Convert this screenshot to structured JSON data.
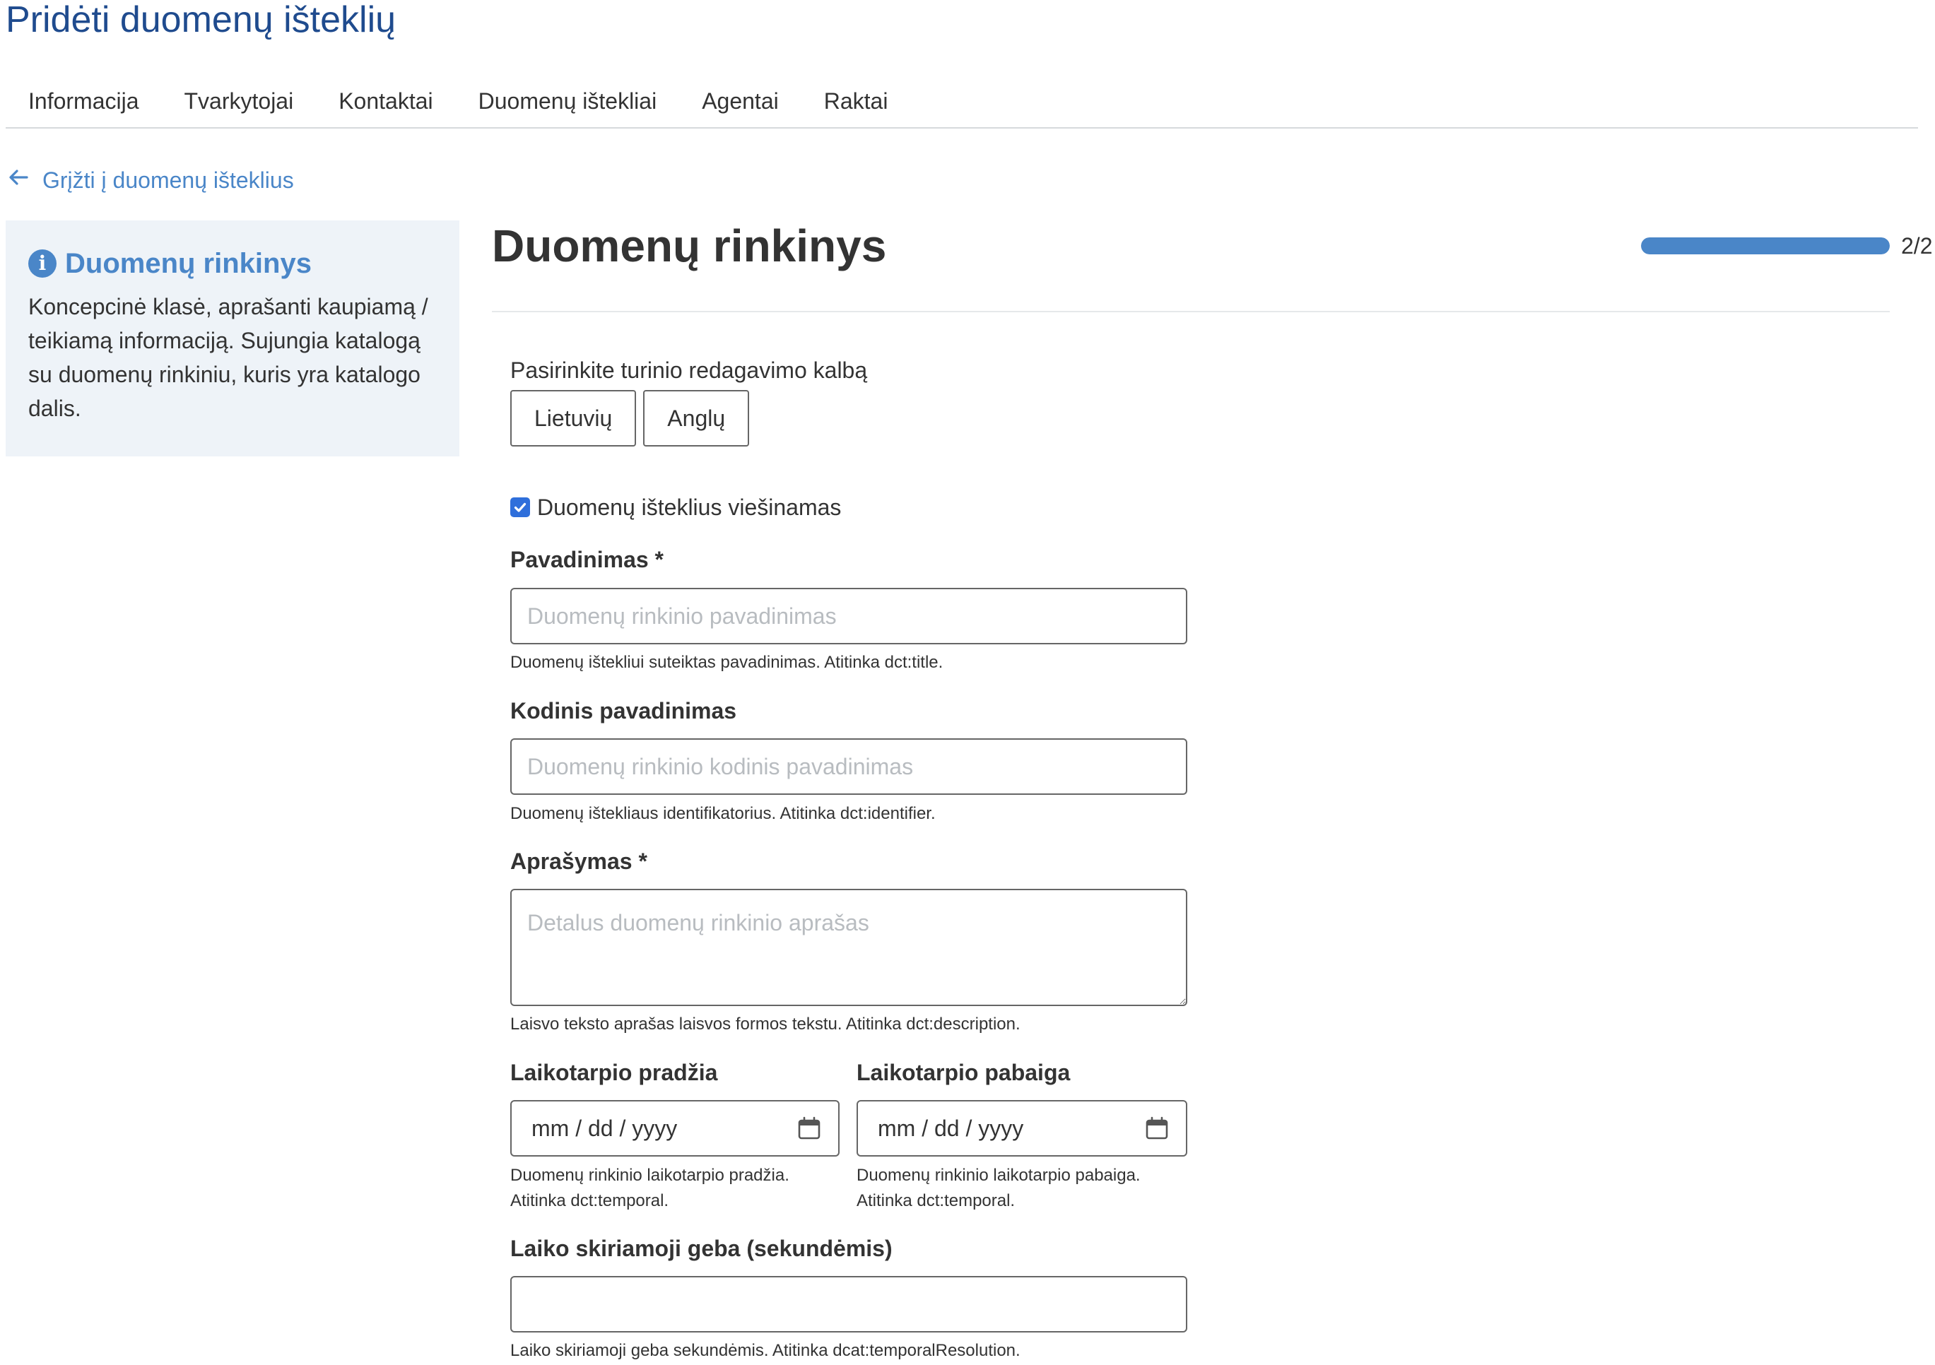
{
  "page": {
    "title": "Pridėti duomenų išteklių"
  },
  "tabs": [
    {
      "label": "Informacija"
    },
    {
      "label": "Tvarkytojai"
    },
    {
      "label": "Kontaktai"
    },
    {
      "label": "Duomenų ištekliai"
    },
    {
      "label": "Agentai"
    },
    {
      "label": "Raktai"
    }
  ],
  "back_link": {
    "label": "Grįžti į duomenų išteklius"
  },
  "info_panel": {
    "heading": "Duomenų rinkinys",
    "text": "Koncepcinė klasė, aprašanti kaupiamą / teikiamą informaciją. Sujungia katalogą su duomenų rinkiniu, kuris yra katalogo dalis."
  },
  "section": {
    "title": "Duomenų rinkinys",
    "progress_label": "2/2",
    "progress_fraction": 1.0
  },
  "language": {
    "label": "Pasirinkite turinio redagavimo kalbą",
    "options": [
      {
        "label": "Lietuvių"
      },
      {
        "label": "Anglų"
      }
    ]
  },
  "published_checkbox": {
    "label": "Duomenų išteklius viešinamas",
    "checked": true
  },
  "fields": {
    "name": {
      "label": "Pavadinimas *",
      "placeholder": "Duomenų rinkinio pavadinimas",
      "help": "Duomenų ištekliui suteiktas pavadinimas. Atitinka dct:title."
    },
    "code_name": {
      "label": "Kodinis pavadinimas",
      "placeholder": "Duomenų rinkinio kodinis pavadinimas",
      "help": "Duomenų ištekliaus identifikatorius. Atitinka dct:identifier."
    },
    "description": {
      "label": "Aprašymas *",
      "placeholder": "Detalus duomenų rinkinio aprašas",
      "help": "Laisvo teksto aprašas laisvos formos tekstu. Atitinka dct:description."
    },
    "period_start": {
      "label": "Laikotarpio pradžia",
      "value": "mm / dd / yyyy",
      "help_line1": "Duomenų rinkinio laikotarpio pradžia.",
      "help_line2": "Atitinka dct:temporal."
    },
    "period_end": {
      "label": "Laikotarpio pabaiga",
      "value": "mm / dd / yyyy",
      "help_line1": "Duomenų rinkinio laikotarpio pabaiga.",
      "help_line2": "Atitinka dct:temporal."
    },
    "temporal_resolution": {
      "label": "Laiko skiriamoji geba (sekundėmis)",
      "value": "",
      "help": "Laiko skiriamoji geba sekundėmis. Atitinka dcat:temporalResolution."
    }
  },
  "icons": {
    "back": "arrow-left-icon",
    "info": "info-circle-icon",
    "check": "checkmark-icon",
    "calendar": "calendar-icon"
  },
  "colors": {
    "title_blue": "#1f4b8e",
    "accent_blue": "#4a86c8",
    "panel_bg": "#eef3f8",
    "checkbox_blue": "#2f6fdb"
  }
}
